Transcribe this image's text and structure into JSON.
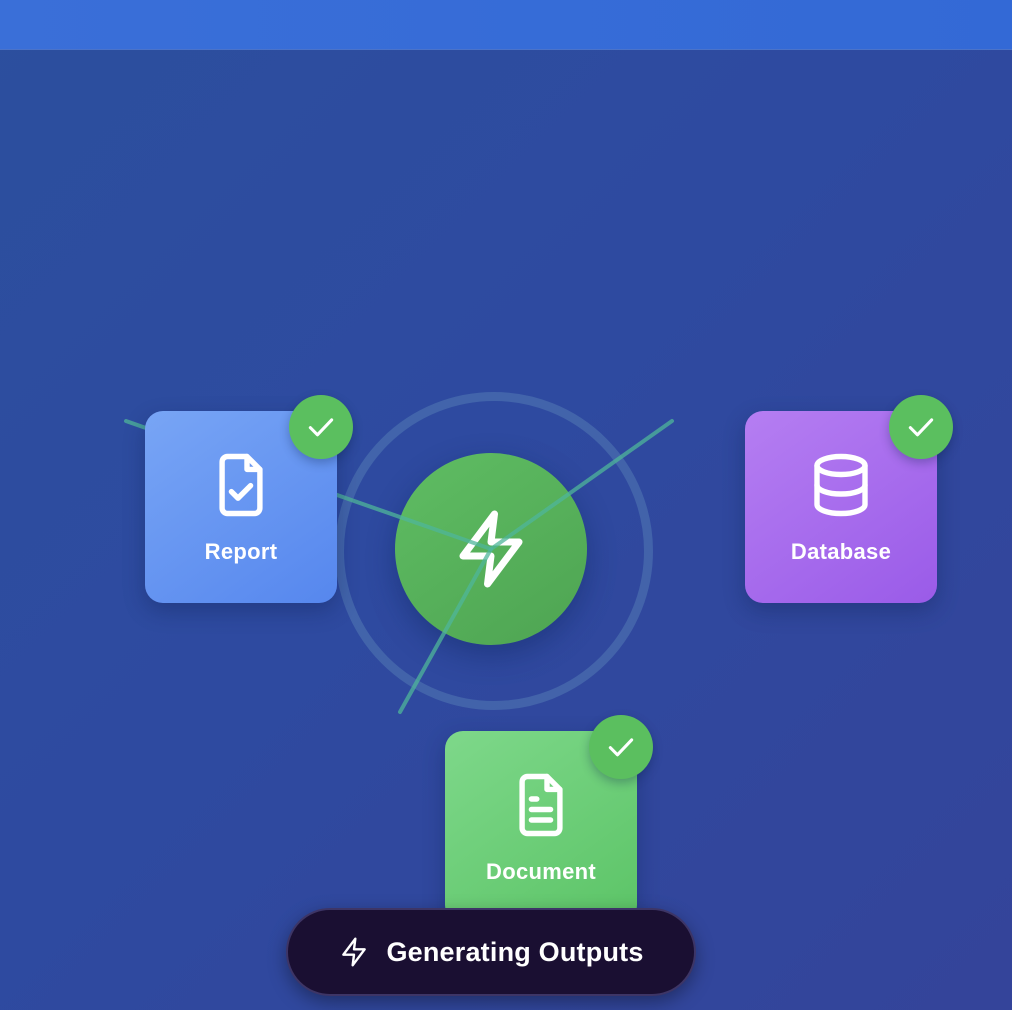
{
  "outputs": [
    {
      "label": "Report",
      "icon": "file-check-icon",
      "status": "complete",
      "color": "#5c8cef"
    },
    {
      "label": "Database",
      "icon": "database-icon",
      "status": "complete",
      "color": "#a064ea"
    },
    {
      "label": "Document",
      "icon": "file-text-icon",
      "status": "complete",
      "color": "#66ca71"
    }
  ],
  "hub": {
    "icon": "lightning-icon",
    "color": "#56b25a"
  },
  "status": {
    "text": "Generating Outputs",
    "icon": "lightning-icon"
  },
  "colors": {
    "background": "#2e4aa0",
    "topbar": "#3a6cd7",
    "check_badge": "#5bbf5f",
    "connector": "#4fb59a",
    "pill": "#1a0f32"
  }
}
